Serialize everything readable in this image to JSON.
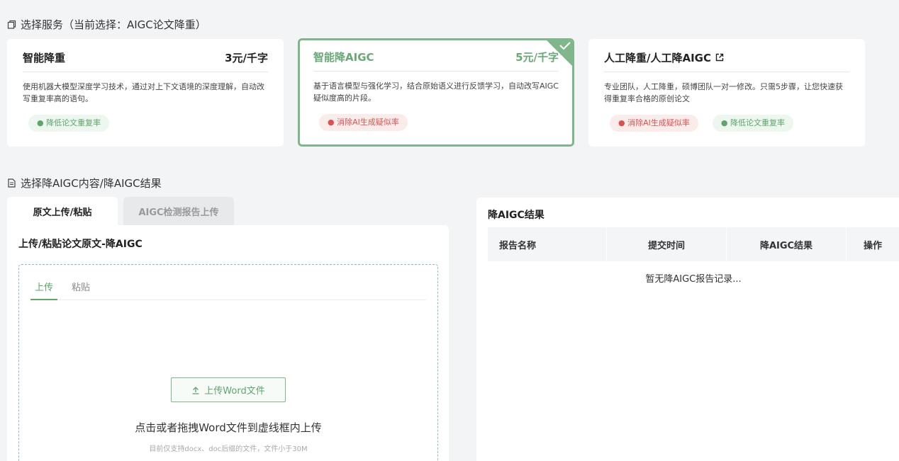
{
  "service_section": {
    "title": "选择服务（当前选择：AIGC论文降重）"
  },
  "services": [
    {
      "name": "智能降重",
      "price": "3元/千字",
      "desc": "使用机器大模型深度学习技术，通过对上下文语境的深度理解，自动改写重复率高的语句。",
      "tags": [
        {
          "text": "● 降低论文重复率",
          "color": "green"
        }
      ]
    },
    {
      "name": "智能降AIGC",
      "price": "5元/千字",
      "desc": "基于语言模型与强化学习，结合原始语义进行反馈学习，自动改写AIGC疑似度高的片段。",
      "selected": true,
      "tags": [
        {
          "text": "● 消除AI生成疑似率",
          "color": "red"
        }
      ]
    },
    {
      "name": "人工降重/人工降AIGC",
      "price": "",
      "desc": "专业团队，人工降重，硕博团队一对一修改。只需5步骤，让您快速获得重复率合格的原创论文",
      "icon": "external-link-icon",
      "tags": [
        {
          "text": "● 消除AI生成疑似率",
          "color": "red"
        },
        {
          "text": "● 降低论文重复率",
          "color": "green"
        }
      ]
    }
  ],
  "content_section": {
    "title": "选择降AIGC内容/降AIGC结果"
  },
  "main_tabs": [
    "原文上传/粘贴",
    "AIGC检测报告上传"
  ],
  "upload_panel": {
    "title": "上传/粘贴论文原文-降AIGC",
    "sub_tabs": [
      "上传",
      "粘贴"
    ],
    "upload_button": "上传Word文件",
    "drop_text": "点击或者拖拽Word文件到虚线框内上传",
    "hint": "目前仅支持docx、doc后缀的文件，文件小于30M"
  },
  "results": {
    "title": "降AIGC结果",
    "columns": [
      "报告名称",
      "提交时间",
      "降AIGC结果",
      "操作"
    ],
    "empty_text": "暂无降AIGC报告记录..."
  },
  "colors": {
    "accent": "#5ea46c",
    "selected_border": "#7fb68b",
    "tag_red": "#d9534f",
    "background": "#f3f4f6"
  }
}
